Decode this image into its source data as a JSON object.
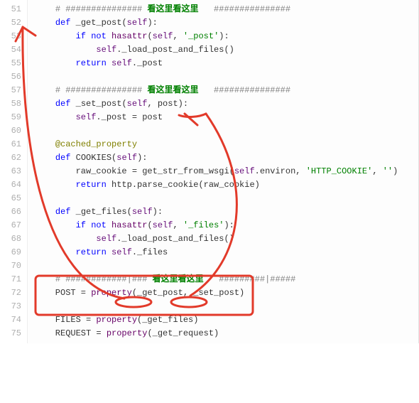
{
  "lines": [
    {
      "num": 51,
      "segs": [
        {
          "t": "    ",
          "c": "n"
        },
        {
          "t": "# ############### ",
          "c": "cm"
        },
        {
          "t": "看这里看这里",
          "c": "hi"
        },
        {
          "t": "   ###############",
          "c": "cm"
        }
      ]
    },
    {
      "num": 52,
      "segs": [
        {
          "t": "    ",
          "c": "n"
        },
        {
          "t": "def ",
          "c": "kw"
        },
        {
          "t": "_get_post",
          "c": "fn"
        },
        {
          "t": "(",
          "c": "n"
        },
        {
          "t": "self",
          "c": "self"
        },
        {
          "t": "):",
          "c": "n"
        }
      ]
    },
    {
      "num": 53,
      "segs": [
        {
          "t": "        ",
          "c": "n"
        },
        {
          "t": "if not ",
          "c": "kw"
        },
        {
          "t": "hasattr",
          "c": "bi"
        },
        {
          "t": "(",
          "c": "n"
        },
        {
          "t": "self",
          "c": "self"
        },
        {
          "t": ", ",
          "c": "n"
        },
        {
          "t": "'_post'",
          "c": "str"
        },
        {
          "t": "):",
          "c": "n"
        }
      ]
    },
    {
      "num": 54,
      "segs": [
        {
          "t": "            ",
          "c": "n"
        },
        {
          "t": "self",
          "c": "self"
        },
        {
          "t": "._load_post_and_files()",
          "c": "n"
        }
      ]
    },
    {
      "num": 55,
      "segs": [
        {
          "t": "        ",
          "c": "n"
        },
        {
          "t": "return ",
          "c": "kw"
        },
        {
          "t": "self",
          "c": "self"
        },
        {
          "t": "._post",
          "c": "n"
        }
      ]
    },
    {
      "num": 56,
      "segs": [
        {
          "t": "",
          "c": "n"
        }
      ]
    },
    {
      "num": 57,
      "segs": [
        {
          "t": "    ",
          "c": "n"
        },
        {
          "t": "# ############### ",
          "c": "cm"
        },
        {
          "t": "看这里看这里",
          "c": "hi"
        },
        {
          "t": "   ###############",
          "c": "cm"
        }
      ]
    },
    {
      "num": 58,
      "segs": [
        {
          "t": "    ",
          "c": "n"
        },
        {
          "t": "def ",
          "c": "kw"
        },
        {
          "t": "_set_post",
          "c": "fn"
        },
        {
          "t": "(",
          "c": "n"
        },
        {
          "t": "self",
          "c": "self"
        },
        {
          "t": ", post):",
          "c": "n"
        }
      ]
    },
    {
      "num": 59,
      "segs": [
        {
          "t": "        ",
          "c": "n"
        },
        {
          "t": "self",
          "c": "self"
        },
        {
          "t": "._post = post",
          "c": "n"
        }
      ]
    },
    {
      "num": 60,
      "segs": [
        {
          "t": "",
          "c": "n"
        }
      ]
    },
    {
      "num": 61,
      "segs": [
        {
          "t": "    ",
          "c": "n"
        },
        {
          "t": "@cached_property",
          "c": "at"
        }
      ]
    },
    {
      "num": 62,
      "segs": [
        {
          "t": "    ",
          "c": "n"
        },
        {
          "t": "def ",
          "c": "kw"
        },
        {
          "t": "COOKIES",
          "c": "fn"
        },
        {
          "t": "(",
          "c": "n"
        },
        {
          "t": "self",
          "c": "self"
        },
        {
          "t": "):",
          "c": "n"
        }
      ]
    },
    {
      "num": 63,
      "segs": [
        {
          "t": "        raw_cookie = get_str_from_wsgi(",
          "c": "n"
        },
        {
          "t": "self",
          "c": "self"
        },
        {
          "t": ".environ, ",
          "c": "n"
        },
        {
          "t": "'HTTP_COOKIE'",
          "c": "str"
        },
        {
          "t": ", ",
          "c": "n"
        },
        {
          "t": "''",
          "c": "str"
        },
        {
          "t": ")",
          "c": "n"
        }
      ]
    },
    {
      "num": 64,
      "segs": [
        {
          "t": "        ",
          "c": "n"
        },
        {
          "t": "return ",
          "c": "kw"
        },
        {
          "t": "http.parse_cookie(raw_cookie)",
          "c": "n"
        }
      ]
    },
    {
      "num": 65,
      "segs": [
        {
          "t": "",
          "c": "n"
        }
      ]
    },
    {
      "num": 66,
      "segs": [
        {
          "t": "    ",
          "c": "n"
        },
        {
          "t": "def ",
          "c": "kw"
        },
        {
          "t": "_get_files",
          "c": "fn"
        },
        {
          "t": "(",
          "c": "n"
        },
        {
          "t": "self",
          "c": "self"
        },
        {
          "t": "):",
          "c": "n"
        }
      ]
    },
    {
      "num": 67,
      "segs": [
        {
          "t": "        ",
          "c": "n"
        },
        {
          "t": "if not ",
          "c": "kw"
        },
        {
          "t": "hasattr",
          "c": "bi"
        },
        {
          "t": "(",
          "c": "n"
        },
        {
          "t": "self",
          "c": "self"
        },
        {
          "t": ", ",
          "c": "n"
        },
        {
          "t": "'_files'",
          "c": "str"
        },
        {
          "t": "):",
          "c": "n"
        }
      ]
    },
    {
      "num": 68,
      "segs": [
        {
          "t": "            ",
          "c": "n"
        },
        {
          "t": "self",
          "c": "self"
        },
        {
          "t": "._load_post_and_files()",
          "c": "n"
        }
      ]
    },
    {
      "num": 69,
      "segs": [
        {
          "t": "        ",
          "c": "n"
        },
        {
          "t": "return ",
          "c": "kw"
        },
        {
          "t": "self",
          "c": "self"
        },
        {
          "t": "._files",
          "c": "n"
        }
      ]
    },
    {
      "num": 70,
      "segs": [
        {
          "t": "",
          "c": "n"
        }
      ]
    },
    {
      "num": 71,
      "segs": [
        {
          "t": "    ",
          "c": "n"
        },
        {
          "t": "# ############|### ",
          "c": "cm"
        },
        {
          "t": "看这里看这里",
          "c": "hi"
        },
        {
          "t": "   #########|#####",
          "c": "cm"
        }
      ]
    },
    {
      "num": 72,
      "segs": [
        {
          "t": "    POST = ",
          "c": "n"
        },
        {
          "t": "property",
          "c": "bi"
        },
        {
          "t": "(_get_post, _set_post)",
          "c": "n"
        }
      ]
    },
    {
      "num": 73,
      "segs": [
        {
          "t": "",
          "c": "n"
        }
      ]
    },
    {
      "num": 74,
      "segs": [
        {
          "t": "    FILES = ",
          "c": "n"
        },
        {
          "t": "property",
          "c": "bi"
        },
        {
          "t": "(_get_files)",
          "c": "n"
        }
      ]
    },
    {
      "num": 75,
      "segs": [
        {
          "t": "    REQUEST = ",
          "c": "n"
        },
        {
          "t": "property",
          "c": "bi"
        },
        {
          "t": "(_get_request)",
          "c": "n"
        }
      ]
    }
  ]
}
